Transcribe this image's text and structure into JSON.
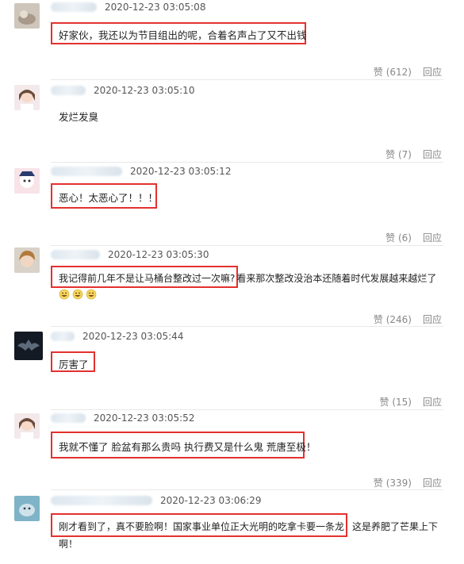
{
  "comments": [
    {
      "time": "2020-12-23 03:05:08",
      "text": "好家伙，我还以为节目组出的呢，合着名声占了又不出钱",
      "likes": "赞 (612)",
      "reply": "回应"
    },
    {
      "time": "2020-12-23 03:05:10",
      "text": "发烂发臭",
      "likes": "赞 (7)",
      "reply": "回应"
    },
    {
      "time": "2020-12-23 03:05:12",
      "text": "恶心！太恶心了！！！",
      "likes": "赞 (6)",
      "reply": "回应"
    },
    {
      "time": "2020-12-23 03:05:30",
      "text_boxed": "我记得前几年不是让马桶台整改过一次嘛?",
      "text_rest": "看来那次整改没治本还随着时代发展越来越烂了",
      "likes": "赞 (246)",
      "reply": "回应"
    },
    {
      "time": "2020-12-23 03:05:44",
      "text": "厉害了",
      "likes": "赞 (15)",
      "reply": "回应"
    },
    {
      "time": "2020-12-23 03:05:52",
      "text": "我就不懂了 脸盆有那么贵吗 执行费又是什么鬼 荒唐至极！",
      "likes": "赞 (339)",
      "reply": "回应"
    },
    {
      "time": "2020-12-23 03:06:29",
      "text_boxed": "刚才看到了，真不要脸啊！国家事业单位正大光明的吃拿卡要一条龙",
      "text_rest": "这是养肥了芒果上下",
      "text_line2": "啊！"
    }
  ],
  "colors": {
    "highlight": "#e3312f",
    "separator": "#e9e9e9"
  }
}
